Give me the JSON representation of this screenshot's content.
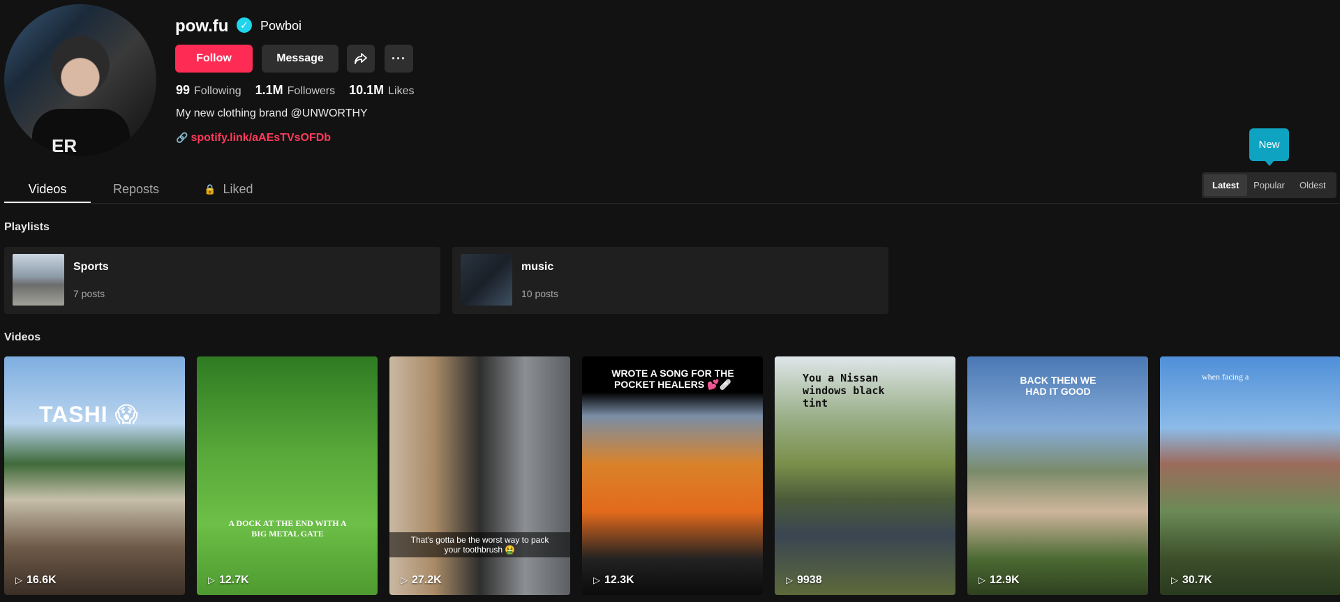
{
  "profile": {
    "username": "pow.fu",
    "nickname": "Powboi",
    "verified_mark": "✓",
    "avatar_text": "ER"
  },
  "actions": {
    "follow": "Follow",
    "message": "Message",
    "share_icon": "share-icon",
    "more": "···"
  },
  "stats": {
    "following_count": "99",
    "following_label": "Following",
    "followers_count": "1.1M",
    "followers_label": "Followers",
    "likes_count": "10.1M",
    "likes_label": "Likes"
  },
  "bio": "My new clothing brand @UNWORTHY",
  "link": "spotify.link/aAEsTVsOFDb",
  "tabs": [
    {
      "label": "Videos"
    },
    {
      "label": "Reposts"
    },
    {
      "label": "Liked"
    }
  ],
  "tooltip": "New",
  "sort": [
    "Latest",
    "Popular",
    "Oldest"
  ],
  "sections": {
    "playlists": "Playlists",
    "videos": "Videos"
  },
  "playlists": [
    {
      "name": "Sports",
      "count": "7 posts"
    },
    {
      "name": "music",
      "count": "10 posts"
    }
  ],
  "videos": [
    {
      "views": "16.6K",
      "overlay": "TASHI 😱"
    },
    {
      "views": "12.7K",
      "overlay": "A DOCK AT THE END WITH A BIG METAL GATE"
    },
    {
      "views": "27.2K",
      "overlay": "That's gotta be the worst way to pack your toothbrush 🤮"
    },
    {
      "views": "12.3K",
      "overlay": "WROTE A SONG FOR THE POCKET HEALERS 💕🩹"
    },
    {
      "views": "9938",
      "overlay": "You a Nissan windows black tint"
    },
    {
      "views": "12.9K",
      "overlay": "BACK THEN WE HAD IT GOOD"
    },
    {
      "views": "30.7K",
      "overlay": "when facing a"
    }
  ],
  "colors": {
    "accent": "#fe2c55",
    "link": "#ff3b5c",
    "tooltip": "#0fa3c2"
  }
}
